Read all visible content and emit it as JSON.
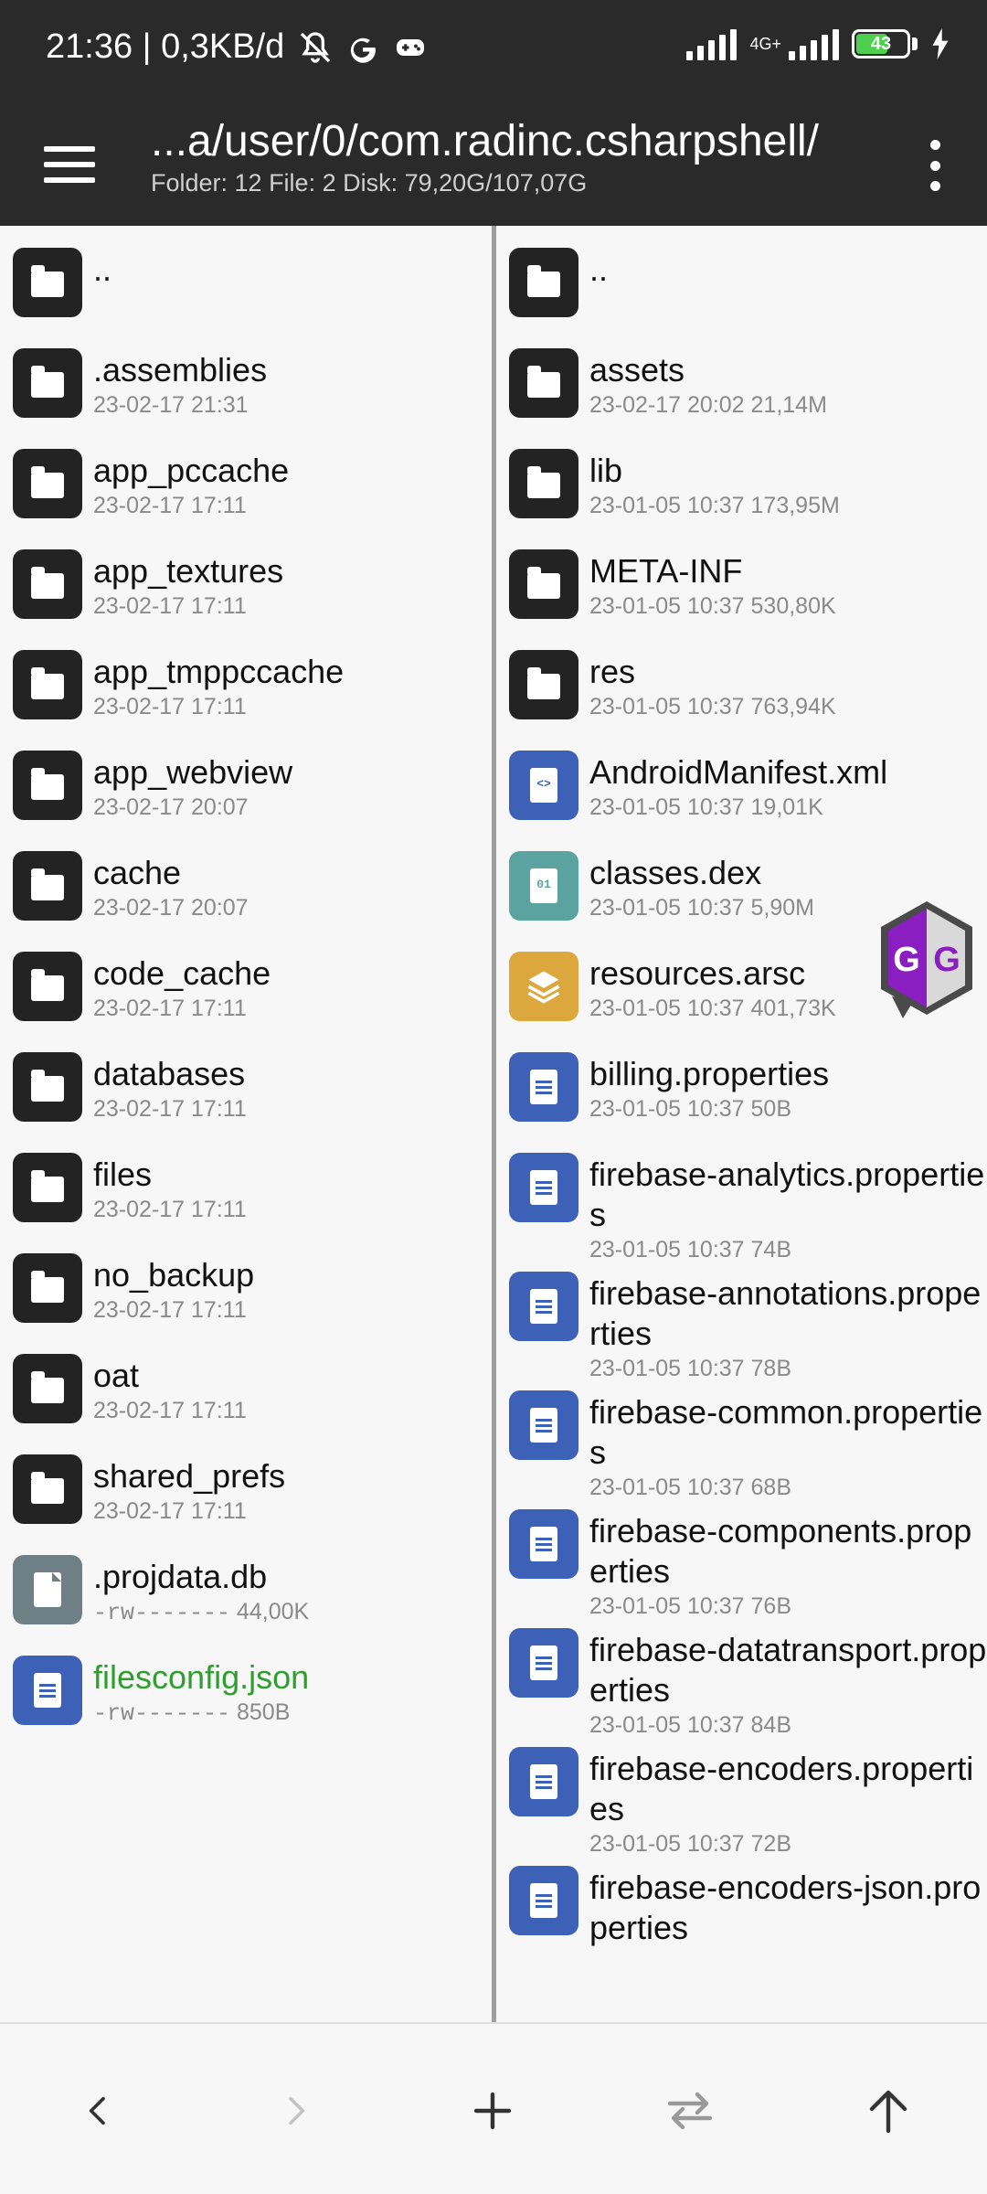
{
  "status_bar": {
    "time_info": "21:36 | 0,3KB/d",
    "network": "4G+",
    "battery": "43",
    "icons": [
      "muted-bell-icon",
      "google-icon",
      "gamepad-icon",
      "signal-icon",
      "battery-icon",
      "charging-icon"
    ]
  },
  "header": {
    "path": "...a/user/0/com.radinc.csharpshell/",
    "stats": "Folder: 12  File: 2  Disk: 79,20G/107,07G"
  },
  "left_panel": [
    {
      "name": "..",
      "meta": "",
      "type": "folder"
    },
    {
      "name": ".assemblies",
      "meta": "23-02-17 21:31",
      "type": "folder"
    },
    {
      "name": "app_pccache",
      "meta": "23-02-17 17:11",
      "type": "folder"
    },
    {
      "name": "app_textures",
      "meta": "23-02-17 17:11",
      "type": "folder"
    },
    {
      "name": "app_tmppccache",
      "meta": "23-02-17 17:11",
      "type": "folder"
    },
    {
      "name": "app_webview",
      "meta": "23-02-17 20:07",
      "type": "folder"
    },
    {
      "name": "cache",
      "meta": "23-02-17 20:07",
      "type": "folder"
    },
    {
      "name": "code_cache",
      "meta": "23-02-17 17:11",
      "type": "folder"
    },
    {
      "name": "databases",
      "meta": "23-02-17 17:11",
      "type": "folder"
    },
    {
      "name": "files",
      "meta": "23-02-17 17:11",
      "type": "folder"
    },
    {
      "name": "no_backup",
      "meta": "23-02-17 17:11",
      "type": "folder"
    },
    {
      "name": "oat",
      "meta": "23-02-17 17:11",
      "type": "folder"
    },
    {
      "name": "shared_prefs",
      "meta": "23-02-17 17:11",
      "type": "folder"
    },
    {
      "name": ".projdata.db",
      "perm": "-rw-------",
      "size": "44,00K",
      "type": "file-grey"
    },
    {
      "name": "filesconfig.json",
      "perm": "-rw-------",
      "size": "850B",
      "type": "file-blue"
    }
  ],
  "right_panel": [
    {
      "name": "..",
      "meta": "",
      "type": "folder"
    },
    {
      "name": "assets",
      "meta": "23-02-17 20:02  21,14M",
      "type": "folder"
    },
    {
      "name": "lib",
      "meta": "23-01-05 10:37  173,95M",
      "type": "folder"
    },
    {
      "name": "META-INF",
      "meta": "23-01-05 10:37  530,80K",
      "type": "folder"
    },
    {
      "name": "res",
      "meta": "23-01-05 10:37  763,94K",
      "type": "folder"
    },
    {
      "name": "AndroidManifest.xml",
      "meta": "23-01-05 10:37  19,01K",
      "type": "xml"
    },
    {
      "name": "classes.dex",
      "meta": "23-01-05 10:37  5,90M",
      "type": "dex"
    },
    {
      "name": "resources.arsc",
      "meta": "23-01-05 10:37  401,73K",
      "type": "arsc"
    },
    {
      "name": "billing.properties",
      "meta": "23-01-05 10:37  50B",
      "type": "file-blue"
    },
    {
      "name": "firebase-analytics.properties",
      "meta": "23-01-05 10:37  74B",
      "type": "file-blue"
    },
    {
      "name": "firebase-annotations.properties",
      "meta": "23-01-05 10:37  78B",
      "type": "file-blue"
    },
    {
      "name": "firebase-common.properties",
      "meta": "23-01-05 10:37  68B",
      "type": "file-blue"
    },
    {
      "name": "firebase-components.properties",
      "meta": "23-01-05 10:37  76B",
      "type": "file-blue"
    },
    {
      "name": "firebase-datatransport.properties",
      "meta": "23-01-05 10:37  84B",
      "type": "file-blue"
    },
    {
      "name": "firebase-encoders.properties",
      "meta": "23-01-05 10:37  72B",
      "type": "file-blue"
    },
    {
      "name": "firebase-encoders-json.properties",
      "meta": "",
      "type": "file-blue"
    }
  ],
  "floating": {
    "label": "GG"
  },
  "toolbar": [
    "back-icon",
    "forward-icon",
    "add-icon",
    "swap-icon",
    "up-icon"
  ]
}
